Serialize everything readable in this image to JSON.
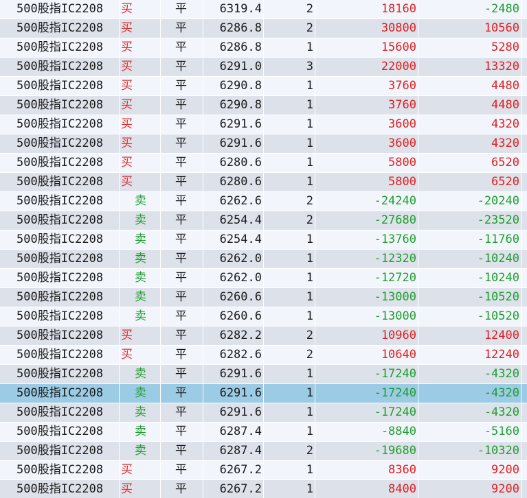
{
  "colors": {
    "row_odd": "#f2f6fc",
    "row_even": "#dde1ea",
    "row_selected": "#9ccbe6",
    "buy_text": "#e03030",
    "sell_text": "#1f9e2e",
    "profit": "#e02020",
    "loss": "#1f9e2e"
  },
  "table": {
    "rows": [
      {
        "contract": "500股指IC2208",
        "direction": "买",
        "offset": "平",
        "price": "6319.4",
        "qty": "2",
        "pnl_a": "18160",
        "pnl_b": "-2480"
      },
      {
        "contract": "500股指IC2208",
        "direction": "买",
        "offset": "平",
        "price": "6286.8",
        "qty": "2",
        "pnl_a": "30800",
        "pnl_b": "10560"
      },
      {
        "contract": "500股指IC2208",
        "direction": "买",
        "offset": "平",
        "price": "6286.8",
        "qty": "1",
        "pnl_a": "15600",
        "pnl_b": "5280"
      },
      {
        "contract": "500股指IC2208",
        "direction": "买",
        "offset": "平",
        "price": "6291.0",
        "qty": "3",
        "pnl_a": "22000",
        "pnl_b": "13320"
      },
      {
        "contract": "500股指IC2208",
        "direction": "买",
        "offset": "平",
        "price": "6290.8",
        "qty": "1",
        "pnl_a": "3760",
        "pnl_b": "4480"
      },
      {
        "contract": "500股指IC2208",
        "direction": "买",
        "offset": "平",
        "price": "6290.8",
        "qty": "1",
        "pnl_a": "3760",
        "pnl_b": "4480"
      },
      {
        "contract": "500股指IC2208",
        "direction": "买",
        "offset": "平",
        "price": "6291.6",
        "qty": "1",
        "pnl_a": "3600",
        "pnl_b": "4320"
      },
      {
        "contract": "500股指IC2208",
        "direction": "买",
        "offset": "平",
        "price": "6291.6",
        "qty": "1",
        "pnl_a": "3600",
        "pnl_b": "4320"
      },
      {
        "contract": "500股指IC2208",
        "direction": "买",
        "offset": "平",
        "price": "6280.6",
        "qty": "1",
        "pnl_a": "5800",
        "pnl_b": "6520"
      },
      {
        "contract": "500股指IC2208",
        "direction": "买",
        "offset": "平",
        "price": "6280.6",
        "qty": "1",
        "pnl_a": "5800",
        "pnl_b": "6520"
      },
      {
        "contract": "500股指IC2208",
        "direction": "卖",
        "offset": "平",
        "price": "6262.6",
        "qty": "2",
        "pnl_a": "-24240",
        "pnl_b": "-20240"
      },
      {
        "contract": "500股指IC2208",
        "direction": "卖",
        "offset": "平",
        "price": "6254.4",
        "qty": "2",
        "pnl_a": "-27680",
        "pnl_b": "-23520"
      },
      {
        "contract": "500股指IC2208",
        "direction": "卖",
        "offset": "平",
        "price": "6254.4",
        "qty": "1",
        "pnl_a": "-13760",
        "pnl_b": "-11760"
      },
      {
        "contract": "500股指IC2208",
        "direction": "卖",
        "offset": "平",
        "price": "6262.0",
        "qty": "1",
        "pnl_a": "-12320",
        "pnl_b": "-10240"
      },
      {
        "contract": "500股指IC2208",
        "direction": "卖",
        "offset": "平",
        "price": "6262.0",
        "qty": "1",
        "pnl_a": "-12720",
        "pnl_b": "-10240"
      },
      {
        "contract": "500股指IC2208",
        "direction": "卖",
        "offset": "平",
        "price": "6260.6",
        "qty": "1",
        "pnl_a": "-13000",
        "pnl_b": "-10520"
      },
      {
        "contract": "500股指IC2208",
        "direction": "卖",
        "offset": "平",
        "price": "6260.6",
        "qty": "1",
        "pnl_a": "-13000",
        "pnl_b": "-10520"
      },
      {
        "contract": "500股指IC2208",
        "direction": "买",
        "offset": "平",
        "price": "6282.2",
        "qty": "2",
        "pnl_a": "10960",
        "pnl_b": "12400"
      },
      {
        "contract": "500股指IC2208",
        "direction": "买",
        "offset": "平",
        "price": "6282.6",
        "qty": "2",
        "pnl_a": "10640",
        "pnl_b": "12240"
      },
      {
        "contract": "500股指IC2208",
        "direction": "卖",
        "offset": "平",
        "price": "6291.6",
        "qty": "1",
        "pnl_a": "-17240",
        "pnl_b": "-4320"
      },
      {
        "contract": "500股指IC2208",
        "direction": "卖",
        "offset": "平",
        "price": "6291.6",
        "qty": "1",
        "pnl_a": "-17240",
        "pnl_b": "-4320",
        "selected": true
      },
      {
        "contract": "500股指IC2208",
        "direction": "卖",
        "offset": "平",
        "price": "6291.6",
        "qty": "1",
        "pnl_a": "-17240",
        "pnl_b": "-4320"
      },
      {
        "contract": "500股指IC2208",
        "direction": "卖",
        "offset": "平",
        "price": "6287.4",
        "qty": "1",
        "pnl_a": "-8840",
        "pnl_b": "-5160"
      },
      {
        "contract": "500股指IC2208",
        "direction": "卖",
        "offset": "平",
        "price": "6287.4",
        "qty": "2",
        "pnl_a": "-19680",
        "pnl_b": "-10320"
      },
      {
        "contract": "500股指IC2208",
        "direction": "买",
        "offset": "平",
        "price": "6267.2",
        "qty": "1",
        "pnl_a": "8360",
        "pnl_b": "9200"
      },
      {
        "contract": "500股指IC2208",
        "direction": "买",
        "offset": "平",
        "price": "6267.2",
        "qty": "1",
        "pnl_a": "8400",
        "pnl_b": "9200"
      }
    ]
  }
}
